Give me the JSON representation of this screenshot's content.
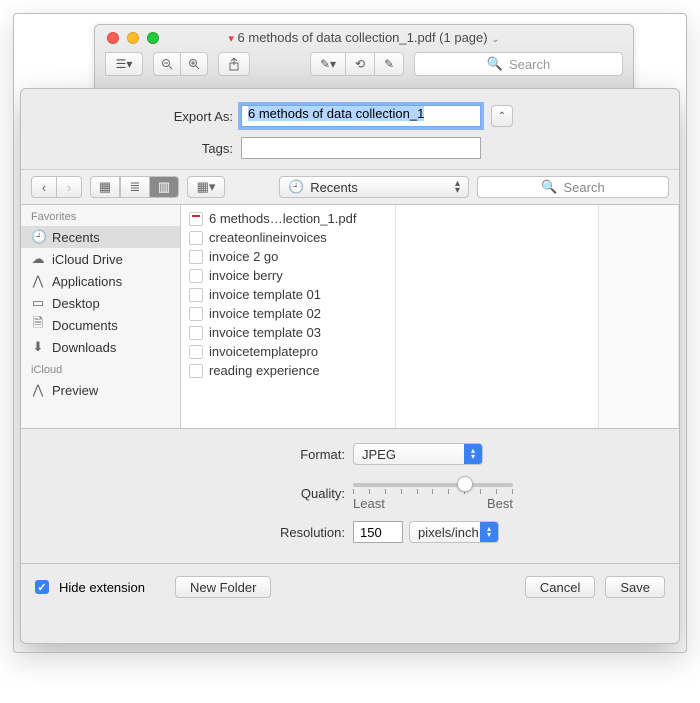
{
  "window": {
    "title": "6 methods of data collection_1.pdf (1 page)"
  },
  "toolbar": {
    "search_placeholder": "Search"
  },
  "export": {
    "export_as_label": "Export As:",
    "filename": "6 methods of data collection_1",
    "tags_label": "Tags:",
    "tags_value": ""
  },
  "browser": {
    "location": "Recents",
    "search_placeholder": "Search",
    "sidebar": {
      "sections": [
        {
          "header": "Favorites",
          "items": [
            {
              "label": "Recents",
              "icon": "clock",
              "selected": true
            },
            {
              "label": "iCloud Drive",
              "icon": "cloud",
              "selected": false
            },
            {
              "label": "Applications",
              "icon": "app",
              "selected": false
            },
            {
              "label": "Desktop",
              "icon": "desktop",
              "selected": false
            },
            {
              "label": "Documents",
              "icon": "doc",
              "selected": false
            },
            {
              "label": "Downloads",
              "icon": "download",
              "selected": false
            }
          ]
        },
        {
          "header": "iCloud",
          "items": [
            {
              "label": "Preview",
              "icon": "app",
              "selected": false
            }
          ]
        }
      ]
    },
    "files": [
      {
        "name": "6 methods…lection_1.pdf",
        "kind": "pdf"
      },
      {
        "name": "createonlineinvoices",
        "kind": "generic"
      },
      {
        "name": "invoice 2 go",
        "kind": "generic"
      },
      {
        "name": "invoice berry",
        "kind": "generic"
      },
      {
        "name": "invoice template 01",
        "kind": "generic"
      },
      {
        "name": "invoice template 02",
        "kind": "generic"
      },
      {
        "name": "invoice template 03",
        "kind": "generic"
      },
      {
        "name": "invoicetemplatepro",
        "kind": "generic"
      },
      {
        "name": "reading experience",
        "kind": "generic"
      }
    ]
  },
  "options": {
    "format_label": "Format:",
    "format_value": "JPEG",
    "quality_label": "Quality:",
    "quality_least": "Least",
    "quality_best": "Best",
    "quality_value": 0.72,
    "resolution_label": "Resolution:",
    "resolution_value": "150",
    "resolution_unit": "pixels/inch"
  },
  "footer": {
    "hide_ext_label": "Hide extension",
    "hide_ext_checked": true,
    "new_folder": "New Folder",
    "cancel": "Cancel",
    "save": "Save"
  }
}
